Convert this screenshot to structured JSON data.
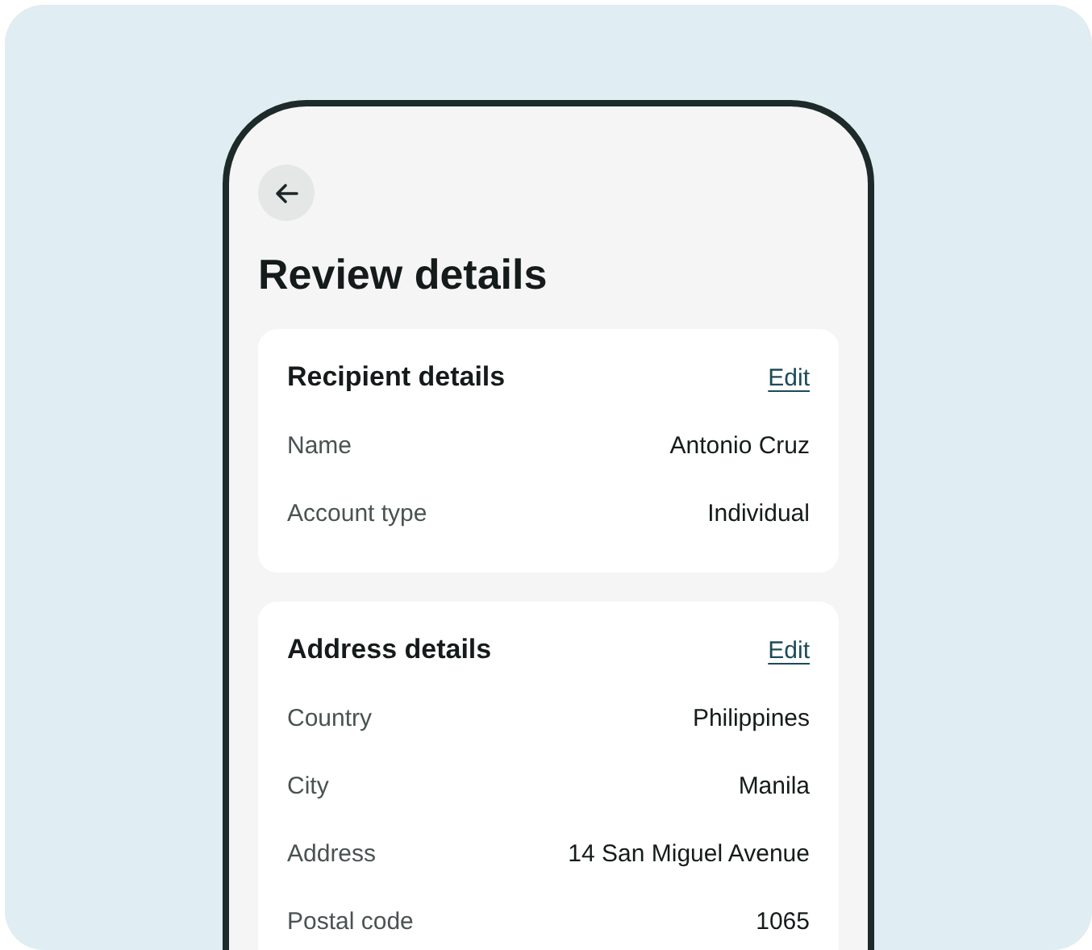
{
  "title": "Review details",
  "sections": [
    {
      "heading": "Recipient details",
      "action": "Edit",
      "rows": [
        {
          "label": "Name",
          "value": "Antonio Cruz"
        },
        {
          "label": "Account type",
          "value": "Individual"
        }
      ]
    },
    {
      "heading": "Address details",
      "action": "Edit",
      "rows": [
        {
          "label": "Country",
          "value": "Philippines"
        },
        {
          "label": "City",
          "value": "Manila"
        },
        {
          "label": "Address",
          "value": "14 San Miguel Avenue"
        },
        {
          "label": "Postal code",
          "value": "1065"
        }
      ]
    }
  ]
}
